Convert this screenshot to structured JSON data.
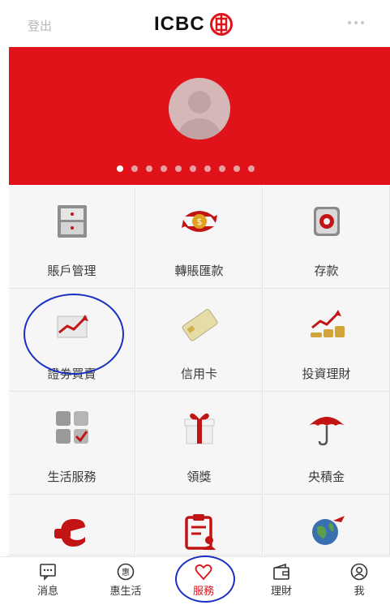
{
  "header": {
    "logout": "登出",
    "logo": "ICBC"
  },
  "banner": {
    "dots": 10,
    "active_dot": 0
  },
  "grid": [
    {
      "label": "賬戶管理",
      "icon": "drawer-icon"
    },
    {
      "label": "轉賬匯款",
      "icon": "transfer-icon"
    },
    {
      "label": "存款",
      "icon": "safe-icon"
    },
    {
      "label": "證劵買賣",
      "icon": "stock-chart-icon"
    },
    {
      "label": "信用卡",
      "icon": "credit-card-icon"
    },
    {
      "label": "投資理財",
      "icon": "investment-icon"
    },
    {
      "label": "生活服務",
      "icon": "services-icon"
    },
    {
      "label": "領獎",
      "icon": "gift-icon"
    },
    {
      "label": "央積金",
      "icon": "umbrella-icon"
    },
    {
      "label": "",
      "icon": "e-payment-icon"
    },
    {
      "label": "",
      "icon": "clipboard-user-icon"
    },
    {
      "label": "",
      "icon": "globe-icon"
    }
  ],
  "tabs": [
    {
      "label": "消息",
      "icon": "message-icon"
    },
    {
      "label": "惠生活",
      "icon": "hui-icon"
    },
    {
      "label": "服務",
      "icon": "heart-icon"
    },
    {
      "label": "理財",
      "icon": "wallet-icon"
    },
    {
      "label": "我",
      "icon": "user-icon"
    }
  ],
  "colors": {
    "brand_red": "#e0121a",
    "annotation_blue": "#1a2fbf"
  }
}
